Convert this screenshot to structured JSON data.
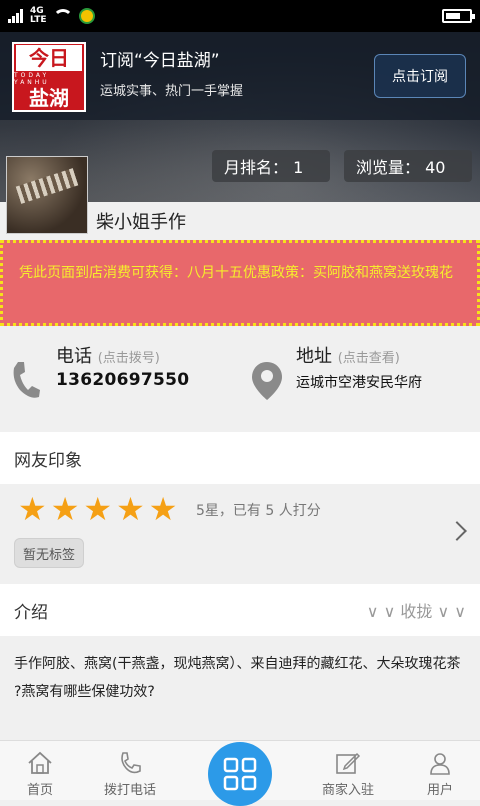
{
  "subscribe": {
    "title": "订阅“今日盐湖”",
    "desc": "运城实事、热门一手掌握",
    "button": "点击订阅",
    "logo_top": "今日",
    "logo_latin": "TODAY  YANHU",
    "logo_bottom": "盐湖"
  },
  "stats": {
    "rank": "月排名： 1",
    "views": "浏览量： 40"
  },
  "store": {
    "name": "柴小姐手作"
  },
  "promo": "凭此页面到店消费可获得：八月十五优惠政策：买阿胶和燕窝送玫瑰花",
  "contact": {
    "phone_label": "电话",
    "phone_hint": "(点击拨号)",
    "phone": "13620697550",
    "address_label": "地址",
    "address_hint": "(点击查看)",
    "address": "运城市空港安民华府"
  },
  "impressions": {
    "title": "网友印象",
    "stars": 5,
    "rating_text": "5星，已有 5 人打分",
    "tag": "暂无标签"
  },
  "intro": {
    "title": "介绍",
    "toggle": "∨ ∨  收拢  ∨ ∨",
    "lines": [
      "手作阿胶、燕窝(干燕盏，现炖燕窝）、来自迪拜的藏红花、大朵玫瑰花茶",
      "?燕窝有哪些保健功效?"
    ]
  },
  "nav": {
    "home": "首页",
    "call": "拨打电话",
    "merchant": "商家入驻",
    "user": "用户"
  },
  "colors": {
    "accent": "#2c9ae8",
    "star": "#f5a015",
    "promo_bg": "#e8686b",
    "promo_text": "#f6ee2c"
  }
}
